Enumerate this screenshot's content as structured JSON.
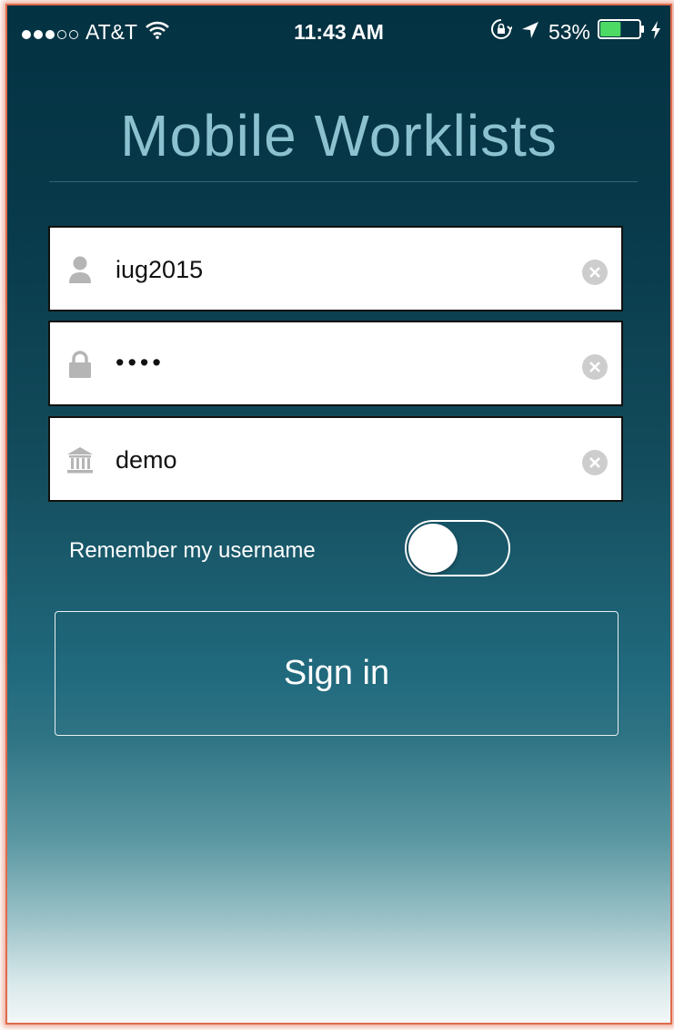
{
  "status_bar": {
    "signal_bars": {
      "filled": 3,
      "total": 5
    },
    "carrier": "AT&T",
    "time": "11:43 AM",
    "battery_percent": "53%",
    "battery_level": 0.53,
    "icons": [
      "signal-dots-icon",
      "wifi-icon",
      "rotation-lock-icon",
      "location-arrow-icon",
      "battery-icon",
      "charging-bolt-icon"
    ]
  },
  "app": {
    "title": "Mobile Worklists"
  },
  "form": {
    "username": {
      "value": "iug2015",
      "icon": "user-icon"
    },
    "password": {
      "value": "••••",
      "icon": "lock-icon"
    },
    "institution": {
      "value": "demo",
      "icon": "institution-icon"
    },
    "remember": {
      "label": "Remember my username",
      "enabled": false
    },
    "sign_in_label": "Sign in"
  },
  "colors": {
    "title": "#8cc1cf",
    "background_top": "#033242",
    "background_mid": "#216a7e",
    "background_bottom": "#f3f7f8",
    "frame_border": "#e06b4c",
    "clear_button": "#cdcdcd",
    "field_icon": "#b5b5b5"
  }
}
